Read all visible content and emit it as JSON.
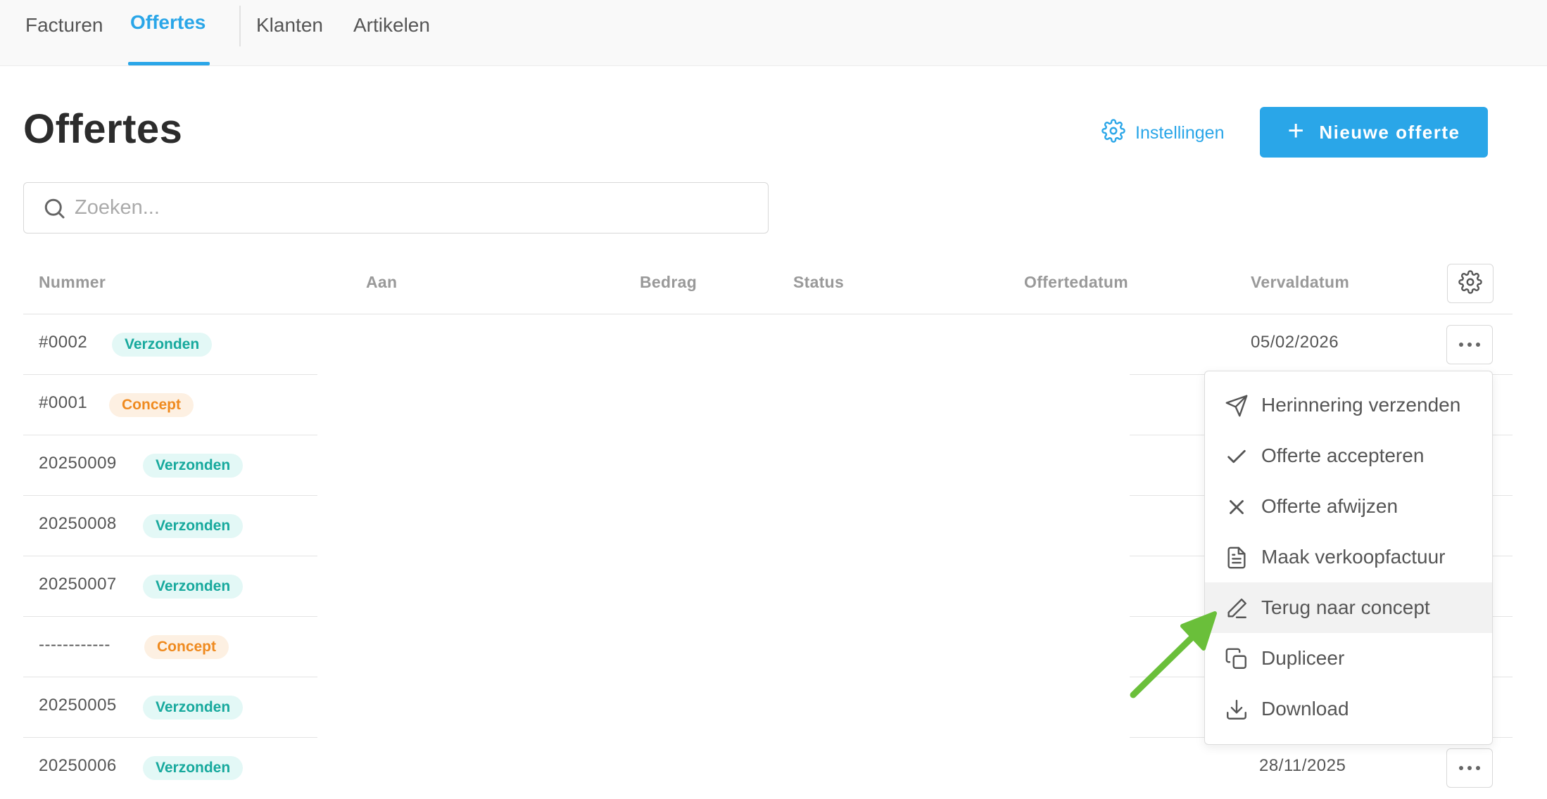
{
  "nav": {
    "tabs": [
      {
        "label": "Facturen"
      },
      {
        "label": "Offertes"
      },
      {
        "label": "Klanten"
      },
      {
        "label": "Artikelen"
      }
    ],
    "active": "Offertes"
  },
  "page": {
    "title": "Offertes",
    "settings_label": "Instellingen",
    "new_button_label": "Nieuwe offerte"
  },
  "search": {
    "placeholder": "Zoeken..."
  },
  "table": {
    "columns": [
      "Nummer",
      "Aan",
      "Bedrag",
      "Status",
      "Offertedatum",
      "Vervaldatum"
    ],
    "rows": [
      {
        "number": "#0002",
        "status": "Verzonden",
        "due": "05/02/2026"
      },
      {
        "number": "#0001",
        "status": "Concept",
        "due": ""
      },
      {
        "number": "20250009",
        "status": "Verzonden",
        "due": ""
      },
      {
        "number": "20250008",
        "status": "Verzonden",
        "due": ""
      },
      {
        "number": "20250007",
        "status": "Verzonden",
        "due": ""
      },
      {
        "number": "------------",
        "status": "Concept",
        "due": ""
      },
      {
        "number": "20250005",
        "status": "Verzonden",
        "due": ""
      },
      {
        "number": "20250006",
        "status": "Verzonden",
        "due": "28/11/2025"
      }
    ]
  },
  "menu": {
    "items": [
      {
        "label": "Herinnering verzenden",
        "icon": "send-icon"
      },
      {
        "label": "Offerte accepteren",
        "icon": "check-icon"
      },
      {
        "label": "Offerte afwijzen",
        "icon": "x-icon"
      },
      {
        "label": "Maak verkoopfactuur",
        "icon": "document-icon"
      },
      {
        "label": "Terug naar concept",
        "icon": "pencil-icon"
      },
      {
        "label": "Dupliceer",
        "icon": "copy-icon"
      },
      {
        "label": "Download",
        "icon": "download-icon"
      }
    ],
    "highlighted": "Terug naar concept"
  },
  "colors": {
    "accent": "#2aa6e8",
    "sent_badge_text": "#17a99d",
    "sent_badge_bg": "#e3f8f6",
    "concept_badge_text": "#ef8a1f",
    "concept_badge_bg": "#fdf0e2",
    "annotation_arrow": "#6abf3a"
  }
}
